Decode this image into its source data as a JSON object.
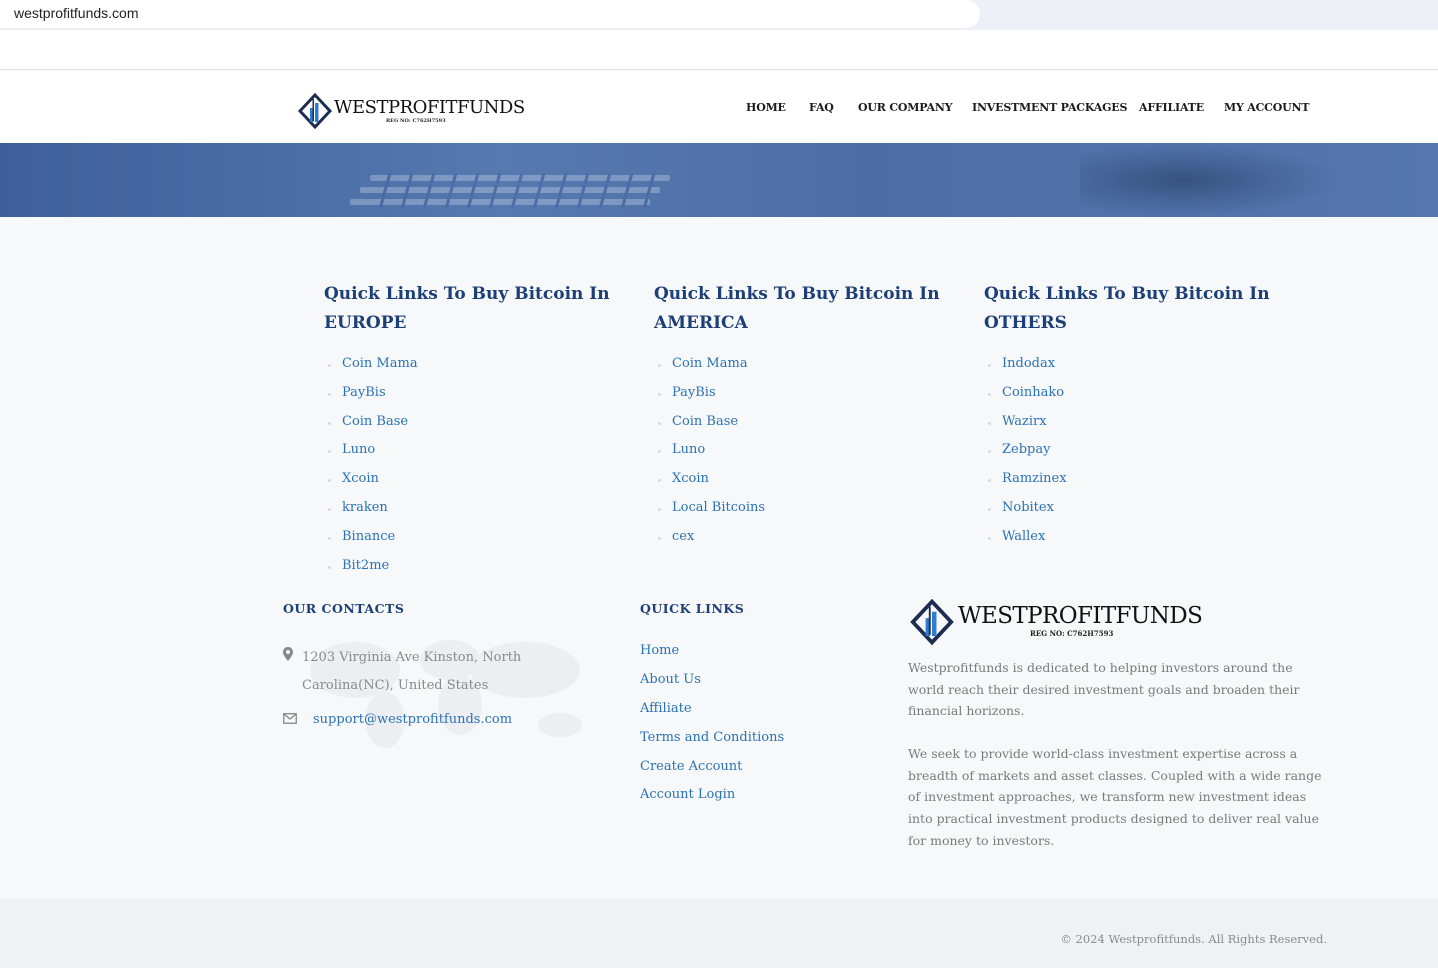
{
  "browser": {
    "url": "westprofitfunds.com"
  },
  "brand": {
    "name": "WESTPROFITFUNDS",
    "reg": "REG NO: C762H7593",
    "primary_color": "#1c3f77",
    "link_color": "#2a72b5",
    "logo_blue": "#2f7bd0"
  },
  "nav": {
    "items": [
      "HOME",
      "FAQ",
      "OUR COMPANY",
      "INVESTMENT PACKAGES",
      "AFFILIATE",
      "MY ACCOUNT"
    ]
  },
  "quick_links": [
    {
      "title": "Quick Links To Buy Bitcoin In EUROPE",
      "items": [
        "Coin Mama",
        "PayBis",
        "Coin Base",
        "Luno",
        "Xcoin",
        "kraken",
        "Binance",
        "Bit2me"
      ]
    },
    {
      "title": "Quick Links To Buy Bitcoin In AMERICA",
      "items": [
        "Coin Mama",
        "PayBis",
        "Coin Base",
        "Luno",
        "Xcoin",
        "Local Bitcoins",
        "cex"
      ]
    },
    {
      "title": "Quick Links To Buy Bitcoin In OTHERS",
      "items": [
        "Indodax",
        "Coinhako",
        "Wazirx",
        "Zebpay",
        "Ramzinex",
        "Nobitex",
        "Wallex"
      ]
    }
  ],
  "footer": {
    "contacts": {
      "heading": "OUR CONTACTS",
      "address": "1203 Virginia Ave Kinston, North Carolina(NC), United States",
      "email": "support@westprofitfunds.com",
      "address_icon": "map-pin-icon",
      "email_icon": "envelope-icon"
    },
    "quick_links": {
      "heading": "QUICK LINKS",
      "items": [
        "Home",
        "About Us",
        "Affiliate",
        "Terms and Conditions",
        "Create Account",
        "Account Login"
      ]
    },
    "about": {
      "p1": "Westprofitfunds is dedicated to helping investors around the world reach their desired investment goals and broaden their financial horizons.",
      "p2": "We seek to provide world-class investment expertise across a breadth of markets and asset classes. Coupled with a wide range of investment approaches, we transform new investment ideas into practical investment products designed to deliver real value for money to investors."
    },
    "copyright": "© 2024 Westprofitfunds. All Rights Reserved."
  }
}
